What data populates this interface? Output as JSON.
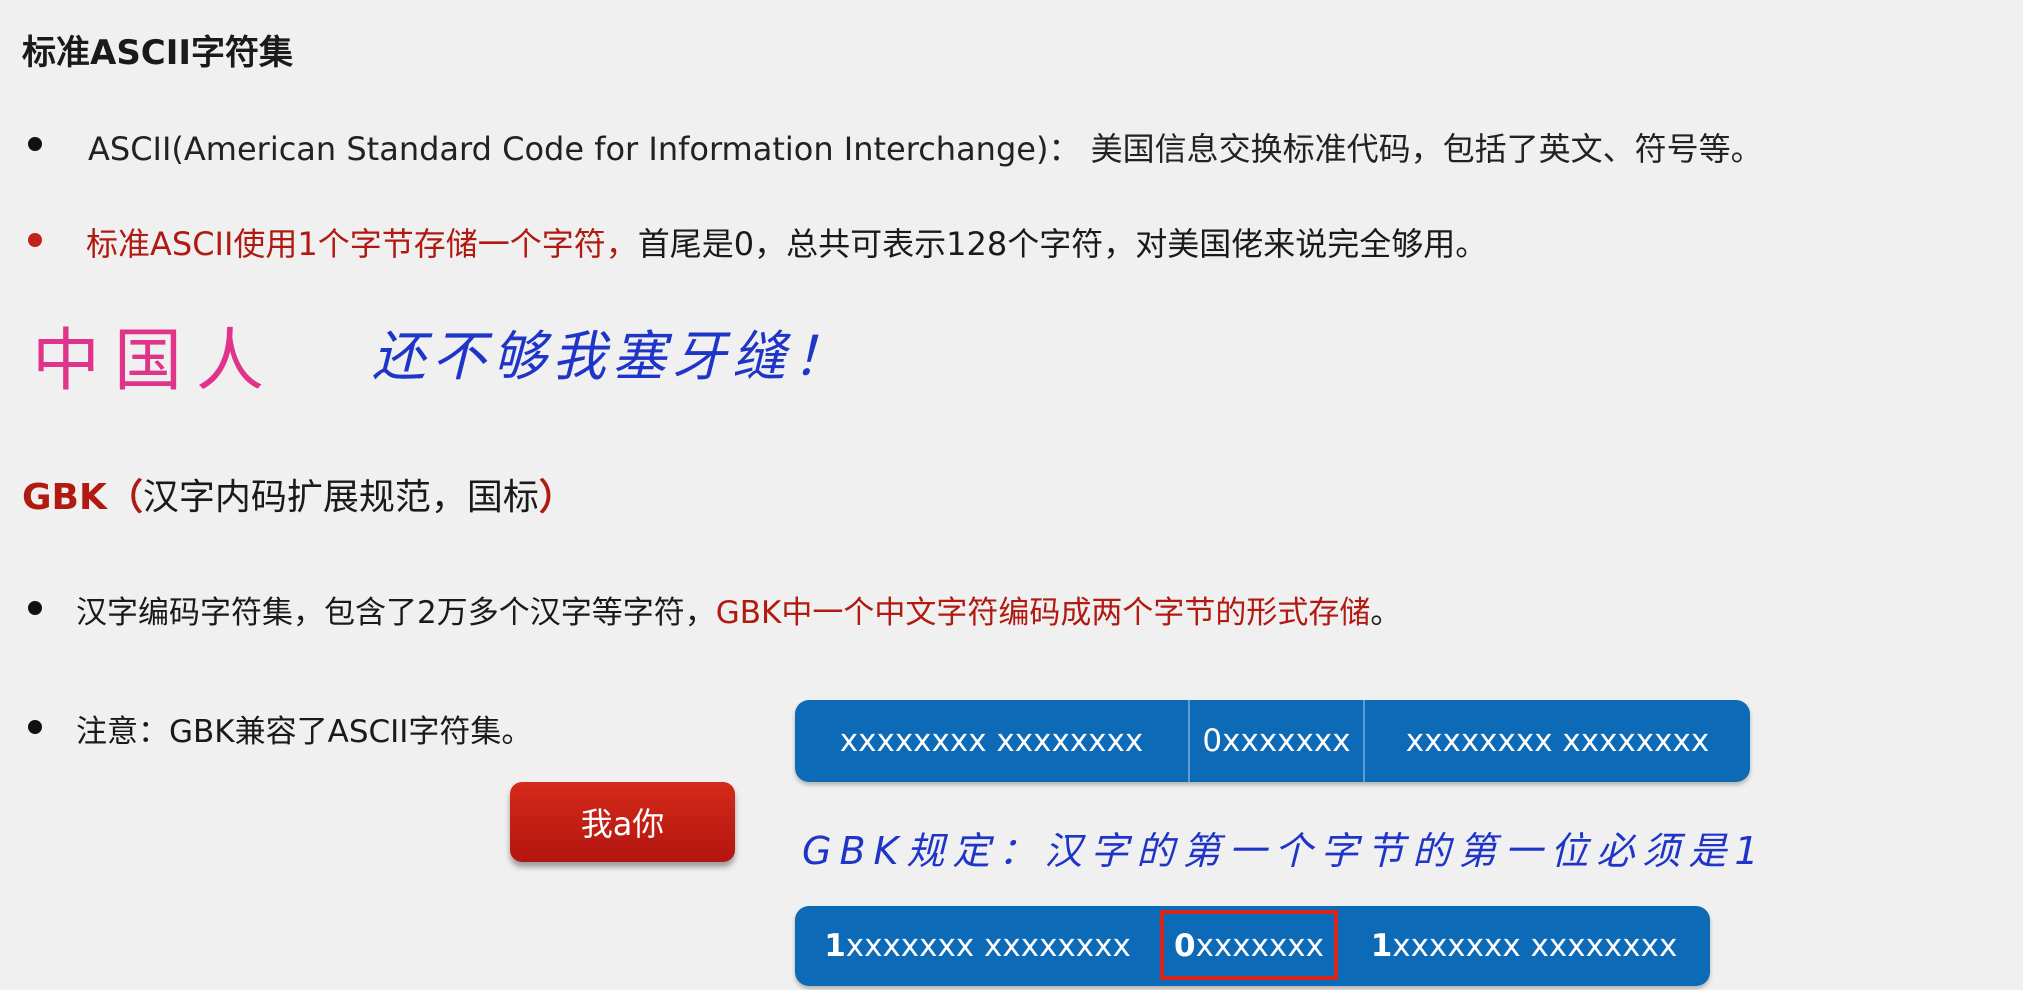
{
  "title": "标准ASCII字符集",
  "bullets": {
    "ascii_desc": "ASCII(American Standard Code for Information Interchange)： 美国信息交换标准代码，包括了英文、符号等。",
    "ascii_red": "标准ASCII使用1个字节存储一个字符，",
    "ascii_rest": "首尾是0，总共可表示128个字符，对美国佬来说完全够用。"
  },
  "handwriting": {
    "pink": "中国人",
    "blue": "还不够我塞牙缝！",
    "gbk_rule": "GBK规定：汉字的第一个字节的第一位必须是1"
  },
  "gbk": {
    "title": "GBK",
    "paren_open": "（",
    "subtitle": "汉字内码扩展规范，国标",
    "paren_close": "）",
    "line1_plain": "汉字编码字符集，包含了2万多个汉字等字符，",
    "line1_red": "GBK中一个中文字符编码成两个字节的形式存储",
    "line1_end": "。",
    "note": "注意：GBK兼容了ASCII字符集。"
  },
  "button_label": "我a你",
  "bar_top": {
    "seg1": "xxxxxxxx  xxxxxxxx",
    "seg2": "0xxxxxxx",
    "seg3": "xxxxxxxx  xxxxxxxx"
  },
  "bar_bottom": {
    "seg1_lead": "1",
    "seg1_rest": "xxxxxxx  xxxxxxxx",
    "seg2_lead": "0",
    "seg2_rest": "xxxxxxx",
    "seg3_lead": "1",
    "seg3_rest": "xxxxxxx  xxxxxxxx"
  },
  "colors": {
    "accent_red": "#b01a10",
    "bar_blue": "#0c6ab7",
    "pink": "#e0338a",
    "ink_blue": "#1f35c8"
  }
}
